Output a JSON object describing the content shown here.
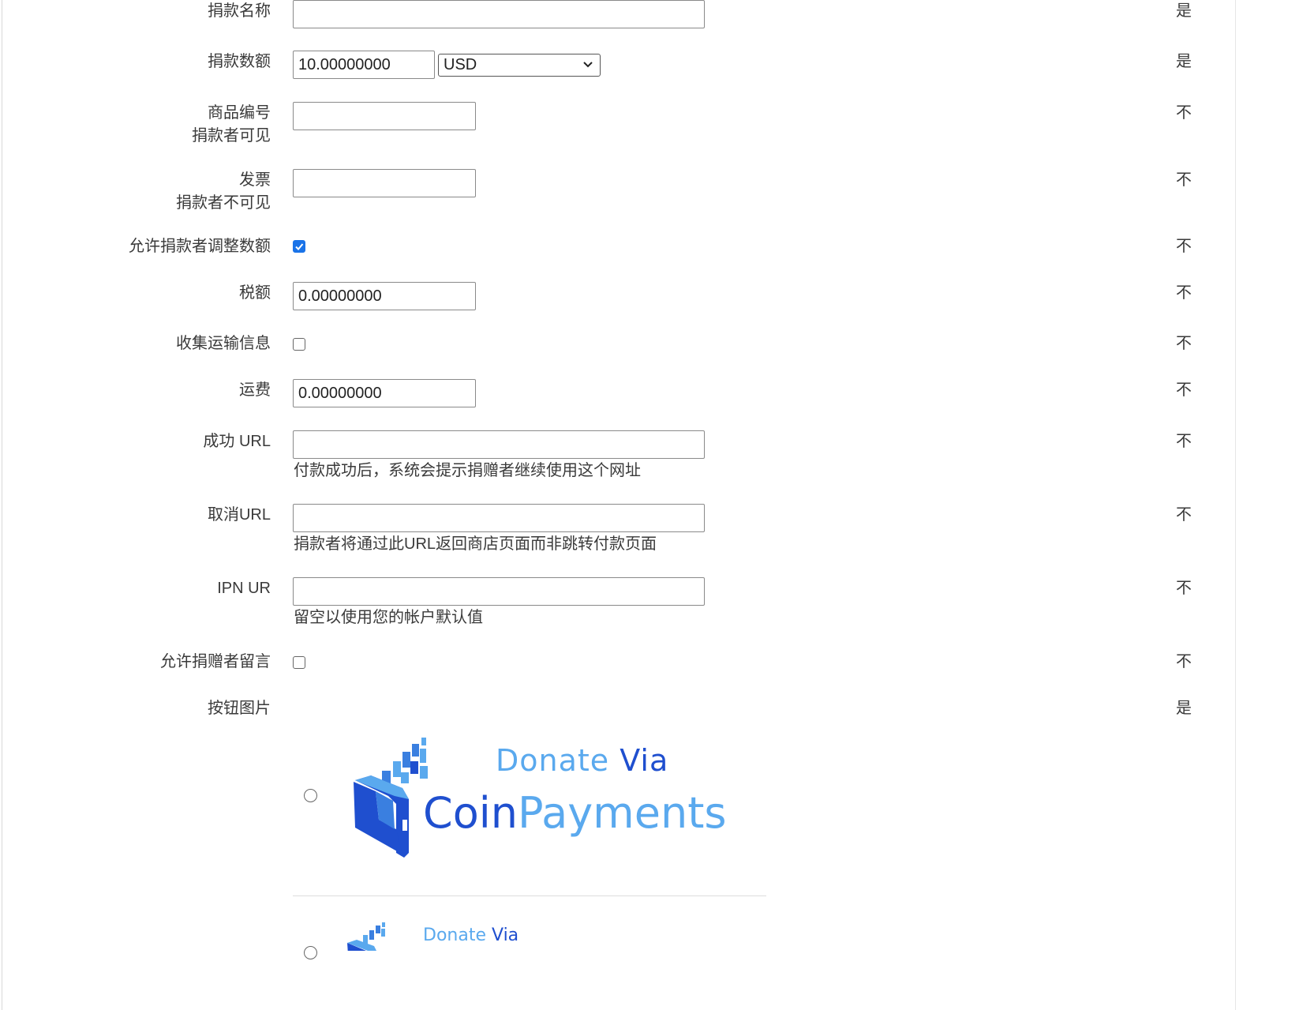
{
  "form": {
    "donation_name": {
      "label": "捐款名称",
      "value": "",
      "required": "是"
    },
    "amount": {
      "label": "捐款数额",
      "value": "10.00000000",
      "currency": "USD",
      "required": "是"
    },
    "item_number": {
      "label_line1": "商品编号",
      "label_line2": "捐款者可见",
      "value": "",
      "required": "不"
    },
    "invoice": {
      "label_line1": "发票",
      "label_line2": "捐款者不可见",
      "value": "",
      "required": "不"
    },
    "allow_adjust": {
      "label": "允许捐款者调整数额",
      "checked": true,
      "required": "不"
    },
    "tax": {
      "label": "税额",
      "value": "0.00000000",
      "required": "不"
    },
    "collect_shipping": {
      "label": "收集运输信息",
      "checked": false,
      "required": "不"
    },
    "shipping": {
      "label": "运费",
      "value": "0.00000000",
      "required": "不"
    },
    "success_url": {
      "label": "成功 URL",
      "value": "",
      "help": "付款成功后，系统会提示捐赠者继续使用这个网址",
      "required": "不"
    },
    "cancel_url": {
      "label": "取消URL",
      "value": "",
      "help": "捐款者将通过此URL返回商店页面而非跳转付款页面",
      "required": "不"
    },
    "ipn_url": {
      "label": "IPN UR",
      "value": "",
      "help": "留空以使用您的帐户默认值",
      "required": "不"
    },
    "allow_note": {
      "label": "允许捐赠者留言",
      "checked": false,
      "required": "不"
    },
    "button_image": {
      "label": "按钮图片",
      "required": "是"
    }
  },
  "logos": [
    {
      "line1_a": "Donate",
      "line1_b": "Via",
      "line2_a": "Coin",
      "line2_b": "Payments",
      "selected": false
    },
    {
      "line1_a": "Donate",
      "line1_b": "Via",
      "selected": false
    }
  ],
  "colors": {
    "brand_dark": "#1f4fcf",
    "brand_light": "#5aa9ee",
    "checkbox_accent": "#1a73e8"
  },
  "icons": {
    "select_arrow": "chevron-down-icon",
    "checkmark": "check-icon"
  }
}
